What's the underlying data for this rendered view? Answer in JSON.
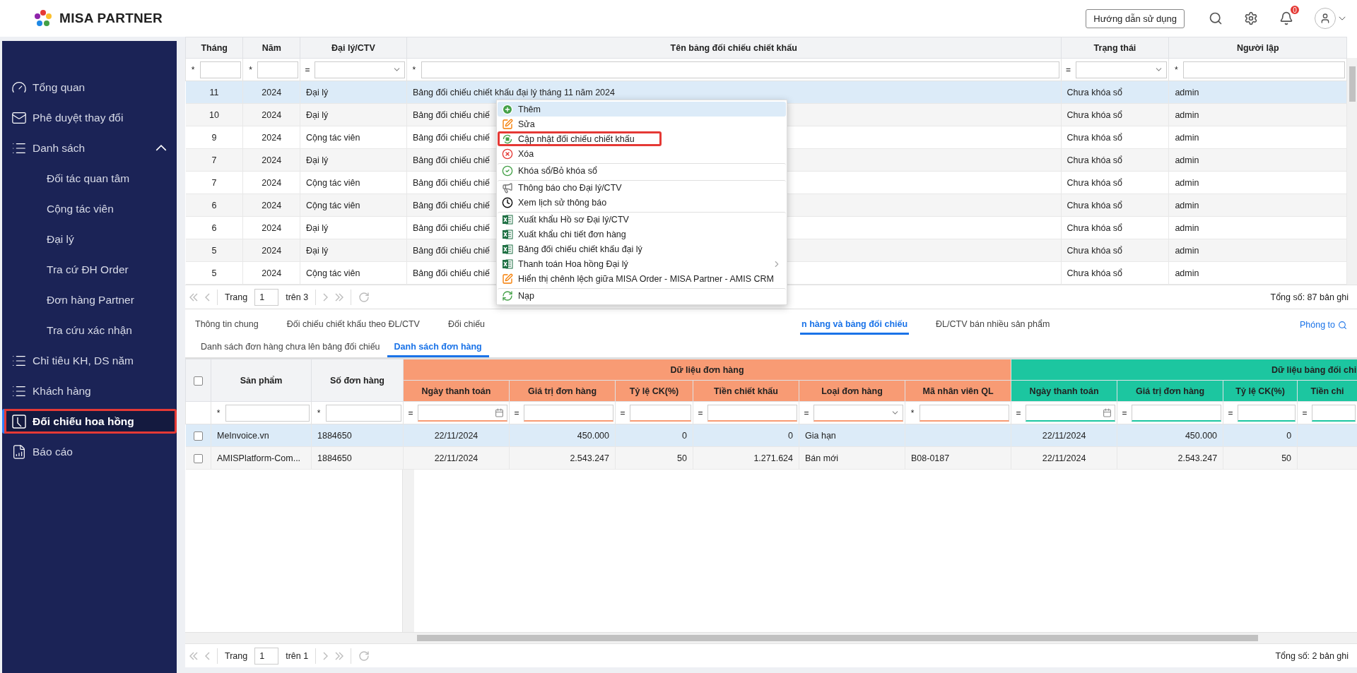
{
  "header": {
    "brand": "MISA PARTNER",
    "guide_button": "Hướng dẫn sử dụng",
    "notification_count": "0"
  },
  "sidebar": {
    "items": [
      {
        "label": "Tổng quan",
        "selected": false,
        "outlined": false
      },
      {
        "label": "Phê duyệt thay đổi",
        "selected": false,
        "outlined": false
      },
      {
        "label": "Danh sách",
        "selected": false,
        "outlined": false,
        "expanded": true,
        "children": [
          {
            "label": "Đối tác quan tâm",
            "selected": false
          },
          {
            "label": "Cộng tác viên",
            "selected": false
          },
          {
            "label": "Đại lý",
            "selected": false
          },
          {
            "label": "Tra cứ ĐH Order",
            "selected": false
          },
          {
            "label": "Đơn hàng Partner",
            "selected": false
          },
          {
            "label": "Tra cứu xác nhận",
            "selected": false
          }
        ]
      },
      {
        "label": "Chỉ tiêu KH, DS năm",
        "selected": false,
        "outlined": false
      },
      {
        "label": "Khách hàng",
        "selected": false,
        "outlined": false
      },
      {
        "label": "Đối chiếu hoa hồng",
        "selected": true,
        "outlined": true
      },
      {
        "label": "Báo cáo",
        "selected": false,
        "outlined": false
      }
    ]
  },
  "upper_grid": {
    "columns": [
      {
        "label": "Tháng"
      },
      {
        "label": "Năm"
      },
      {
        "label": "Đại lý/CTV"
      },
      {
        "label": "Tên bảng đối chiếu chiết khấu"
      },
      {
        "label": "Trạng thái"
      },
      {
        "label": "Người lập"
      }
    ],
    "filters": [
      {
        "operator": "*",
        "kind": "text"
      },
      {
        "operator": "*",
        "kind": "text"
      },
      {
        "operator": "=",
        "kind": "select"
      },
      {
        "operator": "*",
        "kind": "text"
      },
      {
        "operator": "=",
        "kind": "select"
      },
      {
        "operator": "*",
        "kind": "text"
      }
    ],
    "rows": [
      {
        "selected": true,
        "cells": [
          "11",
          "2024",
          "Đại lý",
          "Bảng đối chiếu chiết khấu đại lý tháng 11 năm 2024",
          "Chưa khóa sổ",
          "admin"
        ]
      },
      {
        "selected": false,
        "cells": [
          "10",
          "2024",
          "Đại lý",
          "Bảng đối chiếu chiế",
          "Chưa khóa sổ",
          "admin"
        ]
      },
      {
        "selected": false,
        "cells": [
          "9",
          "2024",
          "Cộng tác viên",
          "Bảng đối chiếu chiế",
          "Chưa khóa sổ",
          "admin"
        ]
      },
      {
        "selected": false,
        "cells": [
          "7",
          "2024",
          "Đại lý",
          "Bảng đối chiếu chiế",
          "Chưa khóa sổ",
          "admin"
        ]
      },
      {
        "selected": false,
        "cells": [
          "7",
          "2024",
          "Cộng tác viên",
          "Bảng đối chiếu chiế",
          "Chưa khóa sổ",
          "admin"
        ]
      },
      {
        "selected": false,
        "cells": [
          "6",
          "2024",
          "Cộng tác viên",
          "Bảng đối chiếu chiế",
          "Chưa khóa sổ",
          "admin"
        ]
      },
      {
        "selected": false,
        "cells": [
          "6",
          "2024",
          "Đại lý",
          "Bảng đối chiếu chiế",
          "Chưa khóa sổ",
          "admin"
        ]
      },
      {
        "selected": false,
        "cells": [
          "5",
          "2024",
          "Đại lý",
          "Bảng đối chiếu chiế",
          "Chưa khóa sổ",
          "admin"
        ]
      },
      {
        "selected": false,
        "cells": [
          "5",
          "2024",
          "Cộng tác viên",
          "Bảng đối chiếu chiế",
          "Chưa khóa sổ",
          "admin"
        ]
      }
    ],
    "pager": {
      "label": "Trang",
      "page": "1",
      "of": "trên 3",
      "total": "Tổng số: 87 bản ghi"
    }
  },
  "context_menu": {
    "items": [
      {
        "label": "Thêm",
        "selected": true,
        "outlined": false,
        "divider_before": false,
        "submenu": false
      },
      {
        "label": "Sửa",
        "selected": false,
        "outlined": false,
        "divider_before": false,
        "submenu": false
      },
      {
        "label": "Cập nhật đối chiếu chiết khấu",
        "selected": false,
        "outlined": true,
        "divider_before": false,
        "submenu": false
      },
      {
        "label": "Xóa",
        "selected": false,
        "outlined": false,
        "divider_before": false,
        "submenu": false
      },
      {
        "label": "Khóa sổ/Bỏ khóa sổ",
        "selected": false,
        "outlined": false,
        "divider_before": true,
        "submenu": false
      },
      {
        "label": "Thông báo cho Đại lý/CTV",
        "selected": false,
        "outlined": false,
        "divider_before": true,
        "submenu": false
      },
      {
        "label": "Xem lịch sử thông báo",
        "selected": false,
        "outlined": false,
        "divider_before": false,
        "submenu": false
      },
      {
        "label": "Xuất khẩu Hồ sơ Đại lý/CTV",
        "selected": false,
        "outlined": false,
        "divider_before": true,
        "submenu": false
      },
      {
        "label": "Xuất khẩu chi tiết đơn hàng",
        "selected": false,
        "outlined": false,
        "divider_before": false,
        "submenu": false
      },
      {
        "label": "Bảng đối chiếu chiết khấu đại lý",
        "selected": false,
        "outlined": false,
        "divider_before": false,
        "submenu": false
      },
      {
        "label": "Thanh toán Hoa hồng Đại lý",
        "selected": false,
        "outlined": false,
        "divider_before": false,
        "submenu": true
      },
      {
        "label": "Hiển thị chênh lệch giữa MISA Order - MISA Partner - AMIS CRM",
        "selected": false,
        "outlined": false,
        "divider_before": false,
        "submenu": false
      },
      {
        "label": "Nạp",
        "selected": false,
        "outlined": false,
        "divider_before": true,
        "submenu": false
      }
    ]
  },
  "tabs": [
    {
      "label": "Thông tin chung",
      "selected": false
    },
    {
      "label": "Đối chiếu chiết khấu theo ĐL/CTV",
      "selected": false
    },
    {
      "label": "Đối chiếu",
      "selected": false
    },
    {
      "label": "n hàng và bảng đối chiếu",
      "selected": true
    },
    {
      "label": "ĐL/CTV bán nhiều sản phẩm",
      "selected": false
    }
  ],
  "zoom_link": "Phóng to",
  "subtabs": [
    {
      "label": "Danh sách đơn hàng chưa lên bảng đối chiếu",
      "selected": false
    },
    {
      "label": "Danh sách đơn hàng",
      "selected": true
    }
  ],
  "lower_grid": {
    "all_checked": false,
    "frozen_columns": [
      {
        "label": "Sản phẩm"
      },
      {
        "label": "Số đơn hàng"
      }
    ],
    "groups": [
      {
        "label": "Dữ liệu đơn hàng",
        "color": "#f89b74",
        "columns": [
          {
            "label": "Ngày thanh toán",
            "kind": "date"
          },
          {
            "label": "Giá trị đơn hàng",
            "kind": "number"
          },
          {
            "label": "Tỷ lệ CK(%)",
            "kind": "number"
          },
          {
            "label": "Tiền chiết khấu",
            "kind": "number"
          },
          {
            "label": "Loại đơn hàng",
            "kind": "text"
          },
          {
            "label": "Mã nhân viên QL",
            "kind": "text"
          }
        ]
      },
      {
        "label": "Dữ liệu bảng đối chi",
        "color": "#1cc6a0",
        "columns": [
          {
            "label": "Ngày thanh toán",
            "kind": "date"
          },
          {
            "label": "Giá trị đơn hàng",
            "kind": "number"
          },
          {
            "label": "Tỷ lệ CK(%)",
            "kind": "number"
          },
          {
            "label": "Tiền chi"
          }
        ]
      }
    ],
    "filters": [
      {
        "operator": "*",
        "kind": "text"
      },
      {
        "operator": "*",
        "kind": "text"
      },
      {
        "operator": "=",
        "kind": "date"
      },
      {
        "operator": "=",
        "kind": "text"
      },
      {
        "operator": "=",
        "kind": "text"
      },
      {
        "operator": "=",
        "kind": "text"
      },
      {
        "operator": "=",
        "kind": "select"
      },
      {
        "operator": "*",
        "kind": "text"
      },
      {
        "operator": "=",
        "kind": "date"
      },
      {
        "operator": "=",
        "kind": "text"
      },
      {
        "operator": "=",
        "kind": "text"
      },
      {
        "operator": "=",
        "kind": "text"
      }
    ],
    "rows": [
      {
        "selected": true,
        "checked": false,
        "cells": [
          "MeInvoice.vn",
          "1884650",
          "22/11/2024",
          "450.000",
          "0",
          "0",
          "Gia hạn",
          null,
          "22/11/2024",
          "450.000",
          "0",
          null
        ]
      },
      {
        "selected": false,
        "checked": false,
        "cells": [
          "AMISPlatform-Com...",
          "1884650",
          "22/11/2024",
          "2.543.247",
          "50",
          "1.271.624",
          "Bán mới",
          "B08-0187",
          "22/11/2024",
          "2.543.247",
          "50",
          null
        ]
      }
    ],
    "pager": {
      "label": "Trang",
      "page": "1",
      "of": "trên 1",
      "total": "Tổng số: 2 bản ghi"
    }
  }
}
